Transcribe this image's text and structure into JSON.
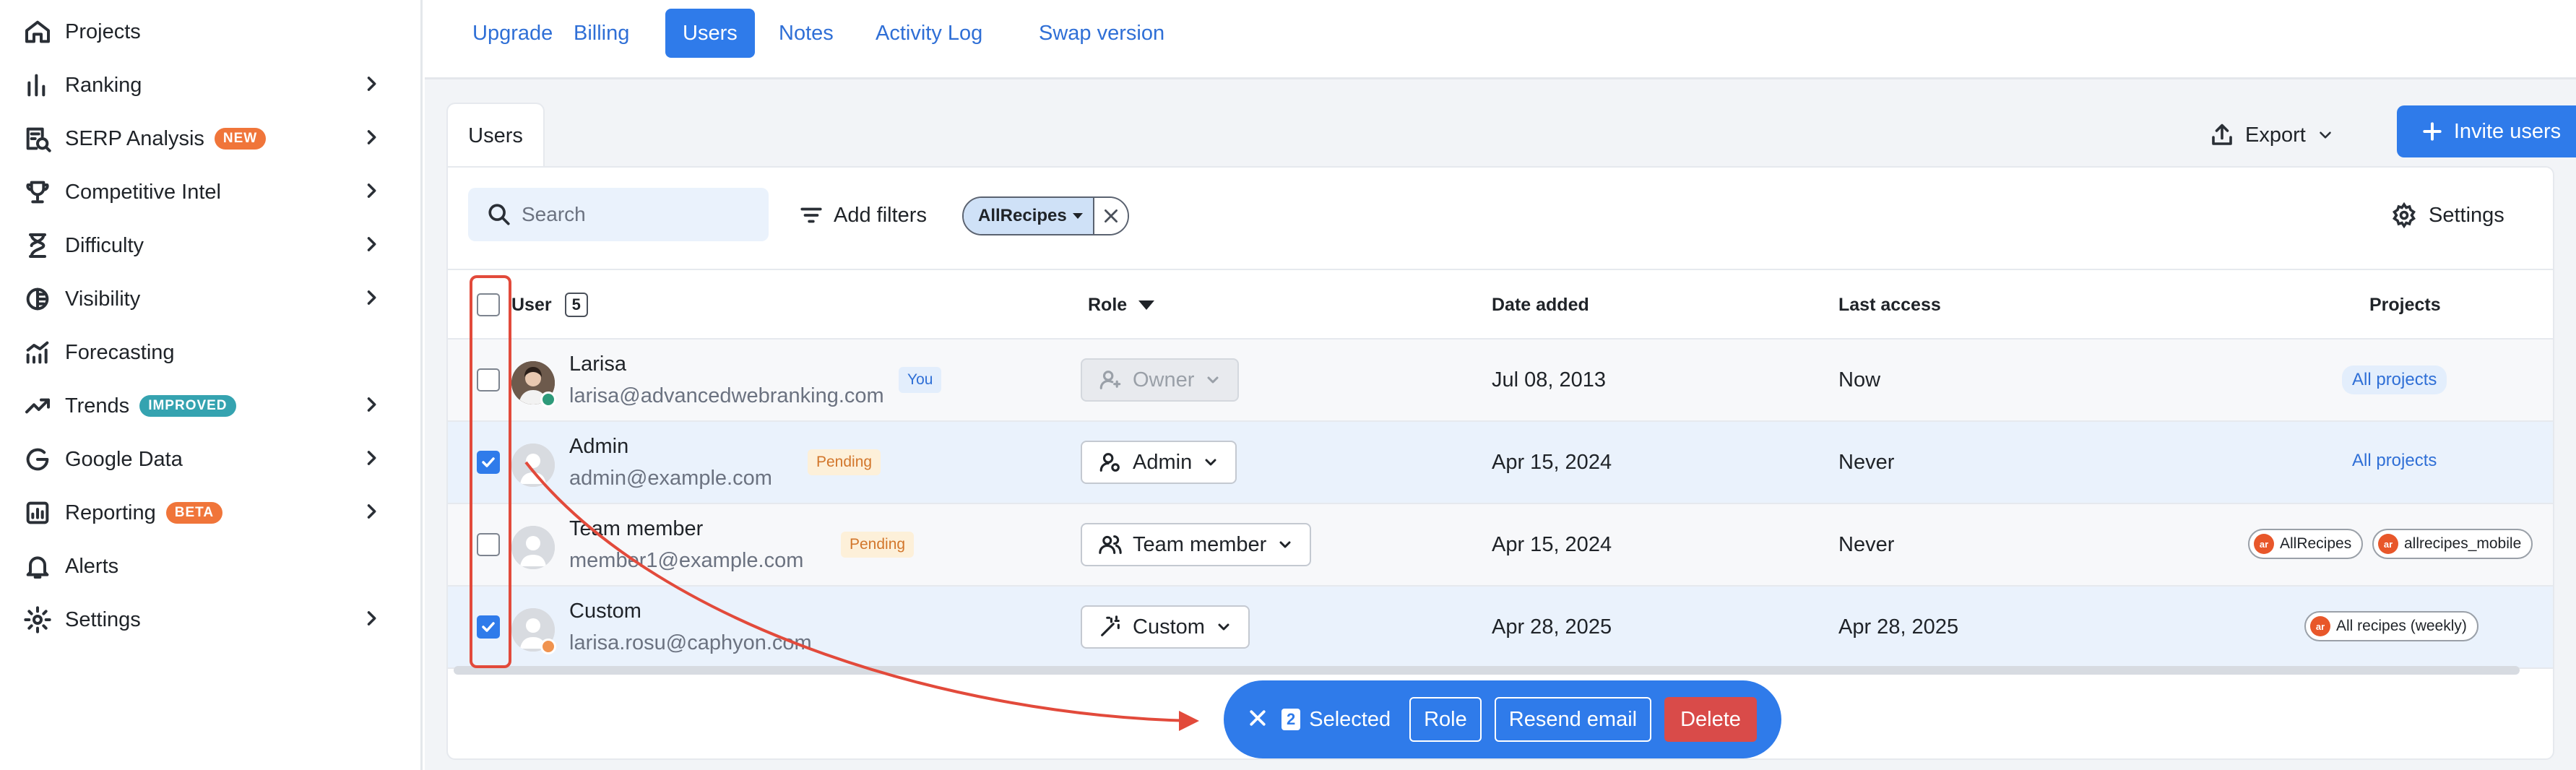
{
  "sidebar": {
    "items": [
      {
        "label": "Projects",
        "icon": "home-icon",
        "chevron": false
      },
      {
        "label": "Ranking",
        "icon": "bar-chart-icon",
        "chevron": true
      },
      {
        "label": "SERP Analysis",
        "icon": "serp-icon",
        "chevron": true,
        "tag": "NEW"
      },
      {
        "label": "Competitive Intel",
        "icon": "trophy-icon",
        "chevron": true
      },
      {
        "label": "Difficulty",
        "icon": "hourglass-icon",
        "chevron": true
      },
      {
        "label": "Visibility",
        "icon": "visibility-icon",
        "chevron": true
      },
      {
        "label": "Forecasting",
        "icon": "forecast-icon",
        "chevron": false
      },
      {
        "label": "Trends",
        "icon": "trend-icon",
        "chevron": true,
        "tag": "IMPROVED"
      },
      {
        "label": "Google Data",
        "icon": "google-icon",
        "chevron": true
      },
      {
        "label": "Reporting",
        "icon": "report-icon",
        "chevron": true,
        "tag": "BETA"
      },
      {
        "label": "Alerts",
        "icon": "bell-icon",
        "chevron": false
      },
      {
        "label": "Settings",
        "icon": "gear-icon",
        "chevron": true
      }
    ]
  },
  "topnav": {
    "tabs": [
      "Upgrade",
      "Billing",
      "Users",
      "Notes",
      "Activity Log",
      "Swap version"
    ],
    "active": "Users"
  },
  "panel": {
    "tab_label": "Users",
    "export_label": "Export",
    "invite_label": "Invite users",
    "search_placeholder": "Search",
    "add_filters_label": "Add filters",
    "filter_chip": "AllRecipes",
    "settings_label": "Settings"
  },
  "table": {
    "headers": {
      "user": "User",
      "user_count": "5",
      "role": "Role",
      "date_added": "Date added",
      "last_access": "Last access",
      "projects": "Projects"
    },
    "rows": [
      {
        "name": "Larisa",
        "email": "larisa@advancedwebranking.com",
        "badge": "You",
        "role": "Owner",
        "date_added": "Jul 08, 2013",
        "last_access": "Now",
        "projects": [
          "All projects"
        ],
        "checked": false
      },
      {
        "name": "Admin",
        "email": "admin@example.com",
        "badge": "Pending",
        "role": "Admin",
        "date_added": "Apr 15, 2024",
        "last_access": "Never",
        "projects": [
          "All projects"
        ],
        "checked": true
      },
      {
        "name": "Team member",
        "email": "member1@example.com",
        "badge": "Pending",
        "role": "Team member",
        "date_added": "Apr 15, 2024",
        "last_access": "Never",
        "projects": [
          "AllRecipes",
          "allrecipes_mobile"
        ],
        "checked": false
      },
      {
        "name": "Custom",
        "email": "larisa.rosu@caphyon.com",
        "badge": "",
        "role": "Custom",
        "date_added": "Apr 28, 2025",
        "last_access": "Apr 28, 2025",
        "projects": [
          "All recipes (weekly)"
        ],
        "checked": true
      }
    ]
  },
  "action_bar": {
    "count": "2",
    "selected_label": "Selected",
    "role_label": "Role",
    "resend_label": "Resend email",
    "delete_label": "Delete"
  },
  "colors": {
    "accent": "#2f7bea",
    "danger": "#d94b49",
    "annotation": "#e24a3b",
    "new_tag": "#f0753a",
    "improved_tag": "#35a3b0"
  }
}
